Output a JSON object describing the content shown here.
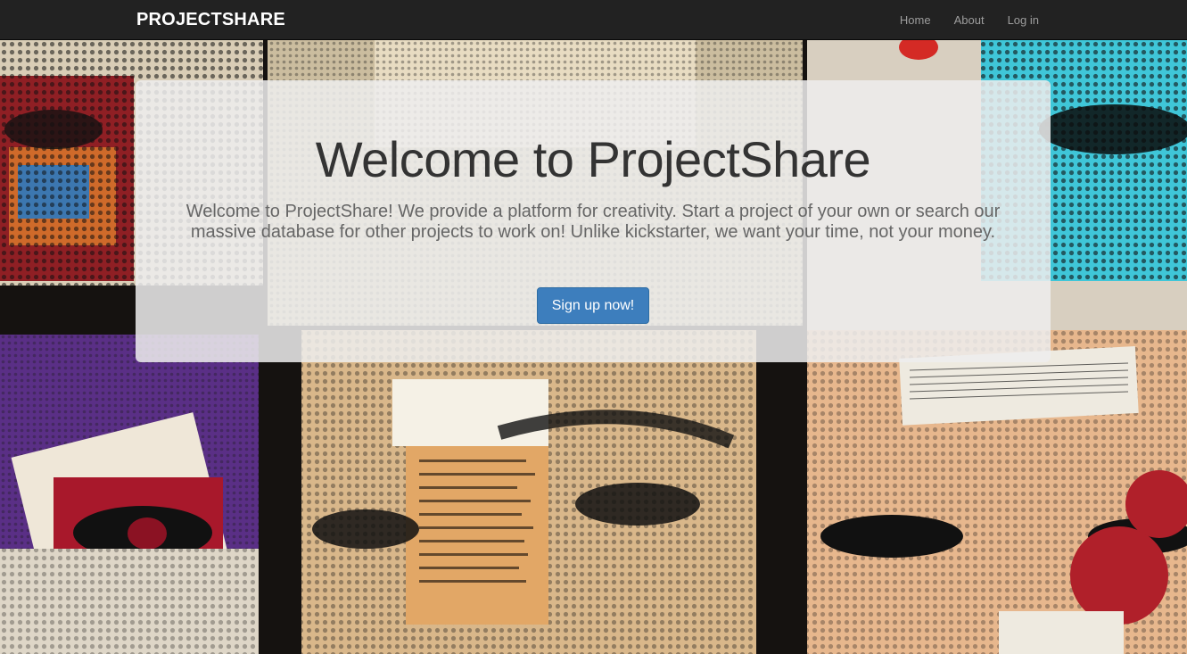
{
  "navbar": {
    "brand": "PROJECTSHARE",
    "links": [
      {
        "label": "Home"
      },
      {
        "label": "About"
      },
      {
        "label": "Log in"
      }
    ]
  },
  "hero": {
    "title": "Welcome to ProjectShare",
    "description": "Welcome to ProjectShare! We provide a platform for creativity. Start a project of your own or search our massive database for other projects to work on! Unlike kickstarter, we want your time, not your money.",
    "cta_label": "Sign up now!"
  },
  "colors": {
    "navbar_bg": "#222222",
    "brand_text": "#ffffff",
    "nav_link": "#9d9d9d",
    "jumbotron_bg": "#eeeeee",
    "title_text": "#333333",
    "body_text": "#666666",
    "primary_button": "#3d7ebd"
  },
  "background_image": "collage-of-halftone-portrait-artworks"
}
